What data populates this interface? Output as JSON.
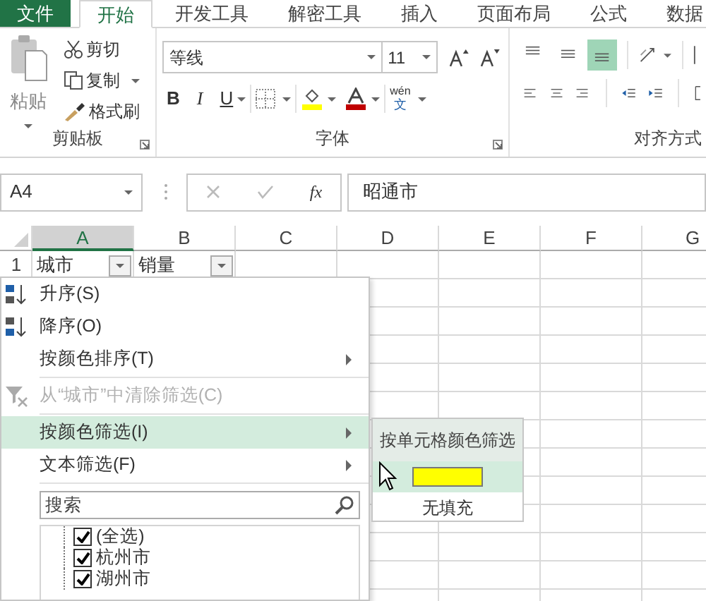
{
  "ribbon_tabs": [
    {
      "label": "文件",
      "kind": "file",
      "selected": false
    },
    {
      "label": "开始",
      "kind": "tab",
      "selected": true
    },
    {
      "label": "开发工具",
      "kind": "tab",
      "selected": false
    },
    {
      "label": "解密工具",
      "kind": "tab",
      "selected": false
    },
    {
      "label": "插入",
      "kind": "tab",
      "selected": false
    },
    {
      "label": "页面布局",
      "kind": "tab",
      "selected": false
    },
    {
      "label": "公式",
      "kind": "tab",
      "selected": false
    },
    {
      "label": "数据",
      "kind": "tab",
      "selected": false
    }
  ],
  "clipboard": {
    "paste": "粘贴",
    "cut": "剪切",
    "copy": "复制",
    "format_painter": "格式刷",
    "label": "剪贴板"
  },
  "font": {
    "name": "等线",
    "size": "11",
    "bold": "B",
    "italic": "I",
    "underline": "U",
    "phonetic_top": "wén",
    "phonetic_bottom": "文",
    "label": "字体"
  },
  "alignment": {
    "vertical": [
      {
        "kind": "top",
        "selected": false
      },
      {
        "kind": "middle",
        "selected": false
      },
      {
        "kind": "bottom",
        "selected": true
      }
    ],
    "label": "对齐方式"
  },
  "formula_bar": {
    "name_box": "A4",
    "function_label": "fx",
    "formula": "昭通市"
  },
  "sheet": {
    "columns": [
      {
        "label": "A",
        "selected": true
      },
      {
        "label": "B",
        "selected": false
      },
      {
        "label": "C",
        "selected": false
      },
      {
        "label": "D",
        "selected": false
      },
      {
        "label": "E",
        "selected": false
      },
      {
        "label": "F",
        "selected": false
      },
      {
        "label": "G",
        "selected": false
      }
    ],
    "rows": [
      {
        "number": "1",
        "cells": [
          {
            "text": "城市",
            "filter": true
          },
          {
            "text": "销量",
            "filter": true
          }
        ]
      }
    ]
  },
  "filter_menu": {
    "items": [
      {
        "kind": "sort-asc",
        "label": "升序(S)",
        "disabled": false,
        "selected": false,
        "submenu": false
      },
      {
        "kind": "sort-desc",
        "label": "降序(O)",
        "disabled": false,
        "selected": false,
        "submenu": false
      },
      {
        "kind": "plain",
        "label": "按颜色排序(T)",
        "disabled": false,
        "selected": false,
        "submenu": true
      },
      {
        "kind": "clear",
        "label": "从“城市”中清除筛选(C)",
        "disabled": true,
        "selected": false,
        "submenu": false
      },
      {
        "kind": "plain",
        "label": "按颜色筛选(I)",
        "disabled": false,
        "selected": true,
        "submenu": true
      },
      {
        "kind": "plain",
        "label": "文本筛选(F)",
        "disabled": false,
        "selected": false,
        "submenu": true
      }
    ],
    "search": {
      "placeholder": "搜索"
    },
    "values": [
      {
        "label": "(全选)",
        "checked": true
      },
      {
        "label": "杭州市",
        "checked": true
      },
      {
        "label": "湖州市",
        "checked": true
      }
    ]
  },
  "color_submenu": {
    "title": "按单元格颜色筛选",
    "items": [
      {
        "kind": "color",
        "color": "#ffff00",
        "selected": true
      },
      {
        "kind": "no-fill",
        "label": "无填充",
        "selected": false
      }
    ]
  }
}
